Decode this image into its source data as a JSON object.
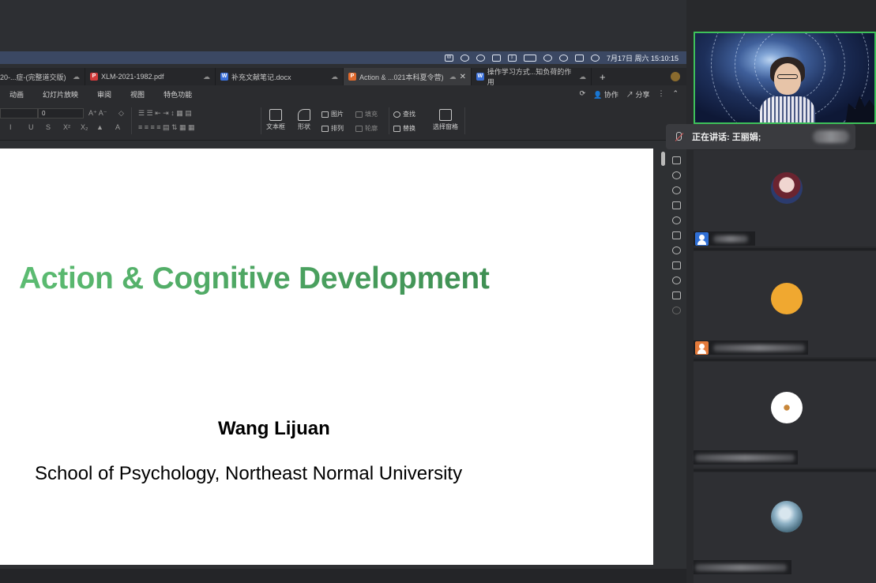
{
  "menubar": {
    "date_time": "7月17日 周六  15:10:15",
    "icons": [
      "wps-icon",
      "wechat-icon",
      "record-icon",
      "grid-icon",
      "bluetooth-icon",
      "battery-icon",
      "wifi-icon",
      "search-icon",
      "control-center-icon",
      "siri-icon"
    ]
  },
  "tabs": [
    {
      "label": "20-...症-(完整道交版)",
      "type": "doc",
      "active": false
    },
    {
      "label": "XLM-2021-1982.pdf",
      "type": "pdf",
      "active": false
    },
    {
      "label": "补充文献笔记.docx",
      "type": "doc",
      "active": false
    },
    {
      "label": "Action & ...021本科夏令营)",
      "type": "ppt",
      "active": true
    },
    {
      "label": "操作学习方式...知负荷的作用",
      "type": "doc",
      "active": false
    }
  ],
  "tab_plus": "+",
  "ribbon_tabs": [
    "动画",
    "幻灯片放映",
    "审阅",
    "视图",
    "特色功能"
  ],
  "ribbon_right": {
    "collab": "协作",
    "share": "分享"
  },
  "ribbon": {
    "font_size_value": "0",
    "textbox": "文本框",
    "shape": "形状",
    "picture": "图片",
    "fill": "填充",
    "arrange": "排列",
    "outline": "轮廓",
    "find": "查找",
    "replace": "替换",
    "select_pane": "选择窗格"
  },
  "slide": {
    "title": "Action & Cognitive Development",
    "author": "Wang Lijuan",
    "affiliation": "School of Psychology, Northeast Normal University"
  },
  "meeting": {
    "speaking_label": "正在讲话: 王丽娟;"
  },
  "colors": {
    "title_green": "#4aa864",
    "active_speaker_border": "#3ec15a",
    "user_blue": "#2f6fd6",
    "user_orange": "#e47a3a",
    "avatar_orange": "#f0a830"
  }
}
